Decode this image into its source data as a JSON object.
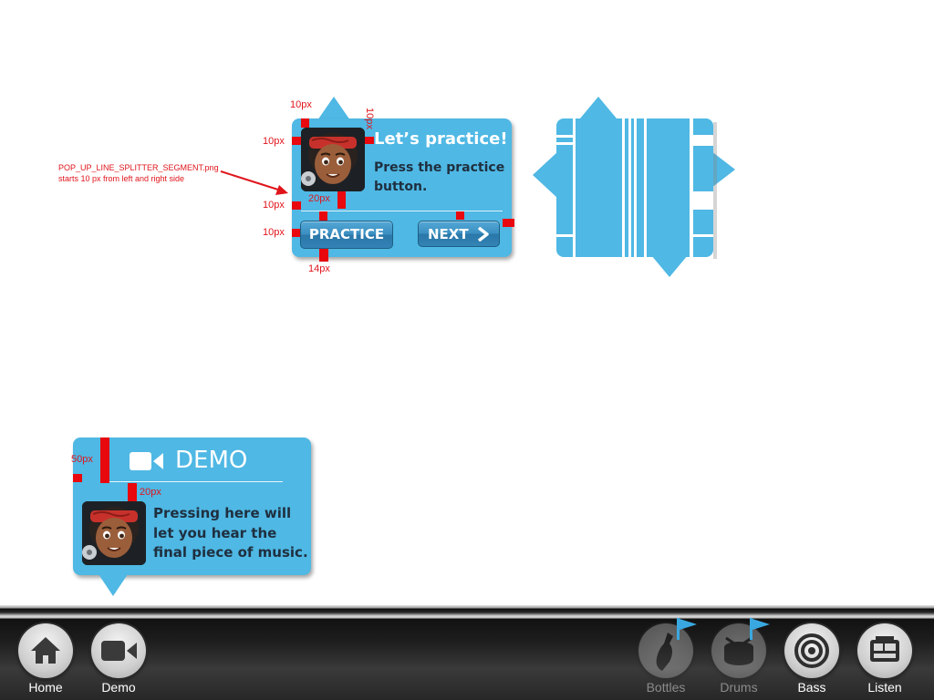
{
  "popup1": {
    "title": "Let’s practice!",
    "body": "Press the practice button.",
    "practice_label": "PRACTICE",
    "next_label": "NEXT"
  },
  "popup3": {
    "title": "DEMO",
    "body": "Pressing here will let you hear the final piece of music."
  },
  "annotations": {
    "note_line1": "POP_UP_LINE_SPLITTER_SEGMENT.png",
    "note_line2": "starts 10 px from left and right side",
    "top_margin": "10px",
    "right_margin": "10px",
    "left_margin": "10px",
    "avatar_gap": "20px",
    "line_gap": "10px",
    "button_gap": "10px",
    "bottom_margin": "14px",
    "demo_header": "50px",
    "demo_gap": "20px"
  },
  "toolbar": {
    "items": [
      {
        "label": "Home",
        "icon": "home-icon"
      },
      {
        "label": "Demo",
        "icon": "video-camera-icon"
      },
      {
        "label": "Bottles",
        "icon": "bottle-icon"
      },
      {
        "label": "Drums",
        "icon": "drum-icon"
      },
      {
        "label": "Bass",
        "icon": "speaker-icon"
      },
      {
        "label": "Listen",
        "icon": "radio-icon"
      }
    ]
  },
  "colors": {
    "popup_blue": "#4fb8e4",
    "annotation_red": "#e0141b",
    "flag_blue": "#3aa8e0",
    "toolbar_dark": "#1e1e1e"
  }
}
